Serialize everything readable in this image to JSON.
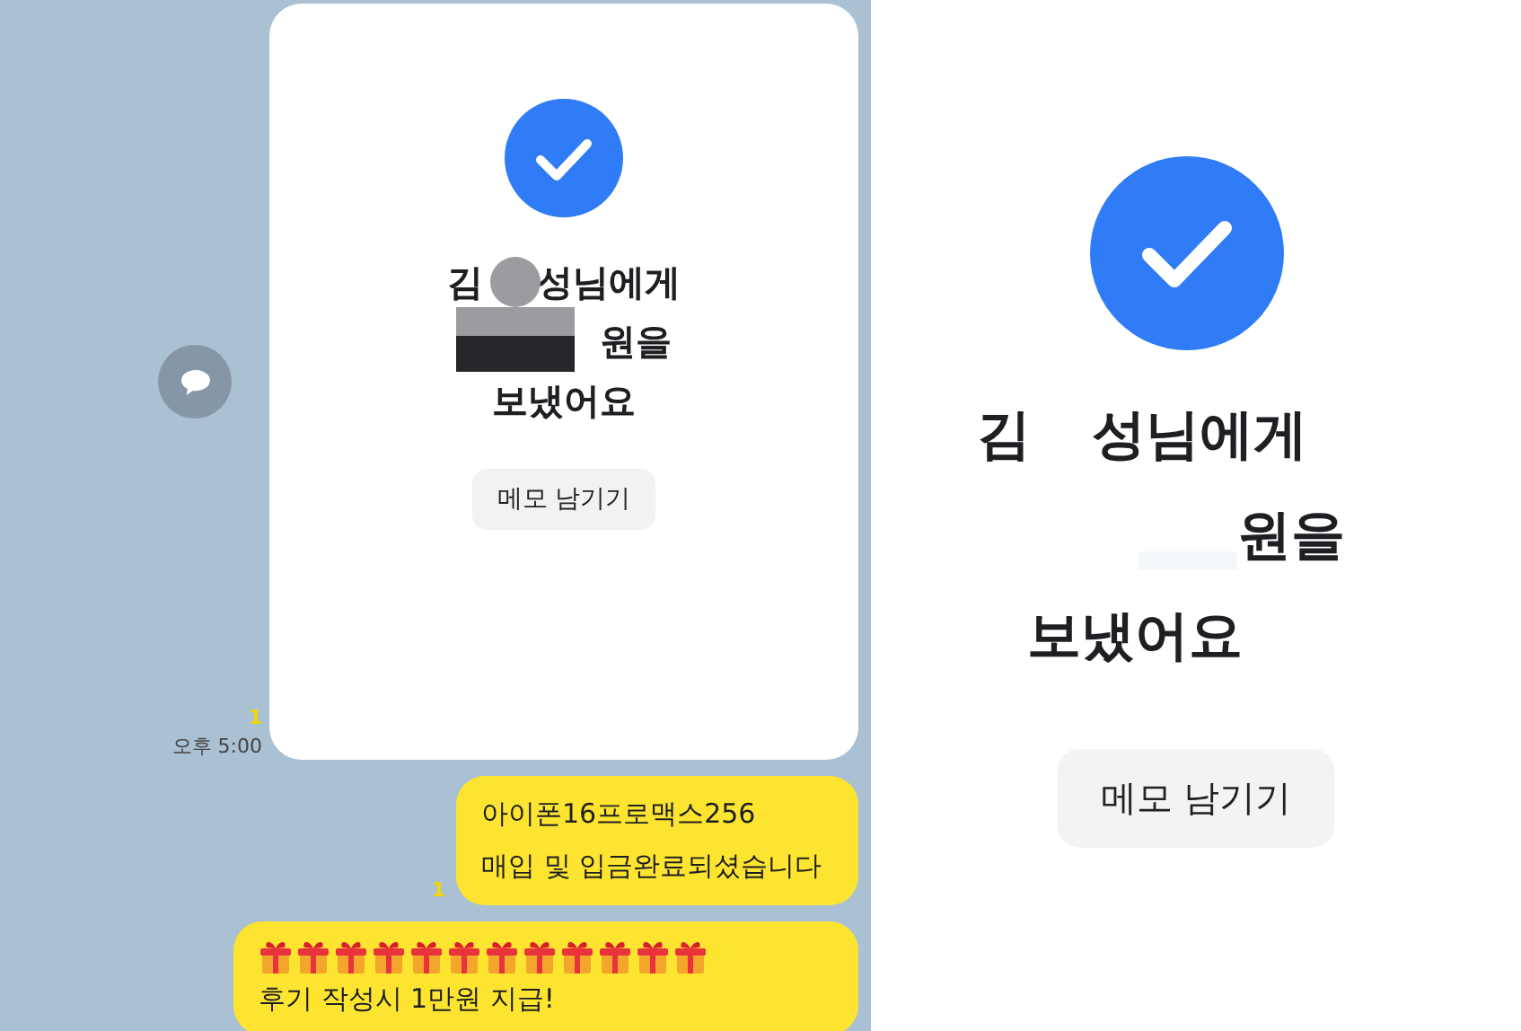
{
  "chat": {
    "transfer_card": {
      "recipient_first": "김",
      "recipient_rest": "성님에게",
      "amount_suffix": "원을",
      "action": "보냈어요",
      "memo_button": "메모 남기기"
    },
    "unread_count": "1",
    "time": "오후 5:00",
    "messages": [
      {
        "kind": "text",
        "unread_count": "1",
        "lines": [
          "아이폰16프로맥스256",
          "매입 및 입금완료되셨습니다"
        ]
      },
      {
        "kind": "promo",
        "lines": [
          "후기 작성시 1만원 지급!"
        ]
      }
    ]
  },
  "detail": {
    "recipient_first": "김",
    "recipient_rest": "성님에게",
    "amount_suffix": "원을",
    "action": "보냈어요",
    "memo_button": "메모 남기기"
  }
}
